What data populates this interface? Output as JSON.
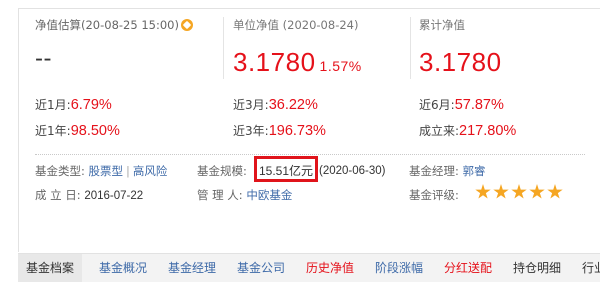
{
  "nav": {
    "estimate_header": "净值估算(20-08-25 15:00)",
    "estimate_value": "--",
    "unit_header": "单位净值 (2020-08-24)",
    "unit_value": "3.1780",
    "unit_change": "1.57%",
    "acc_header": "累计净值",
    "acc_value": "3.1780"
  },
  "performance": [
    {
      "label": "近1月:",
      "value": "6.79%"
    },
    {
      "label": "近3月:",
      "value": "36.22%"
    },
    {
      "label": "近6月:",
      "value": "57.87%"
    },
    {
      "label": "近1年:",
      "value": "98.50%"
    },
    {
      "label": "近3年:",
      "value": "196.73%"
    },
    {
      "label": "成立来:",
      "value": "217.80%"
    }
  ],
  "info": {
    "type_label": "基金类型:",
    "type_value": "股票型",
    "risk_value": "高风险",
    "scale_label": "基金规模:",
    "scale_value": "15.51亿元",
    "scale_date": "(2020-06-30)",
    "manager_label": "基金经理:",
    "manager_value": "郭睿",
    "founded_label": "成 立 日:",
    "founded_value": "2016-07-22",
    "admin_label": "管 理 人:",
    "admin_value": "中欧基金",
    "rating_label": "基金评级:",
    "rating_stars": 5
  },
  "tabs": [
    "基金档案",
    "基金概况",
    "基金经理",
    "基金公司",
    "历史净值",
    "阶段涨幅",
    "分红送配",
    "持仓明细",
    "行业配置"
  ],
  "colors": {
    "accent_red": "#e5111a",
    "link_blue": "#3e6aa8",
    "highlight_box": "#e0141b",
    "star": "#f5a623"
  }
}
